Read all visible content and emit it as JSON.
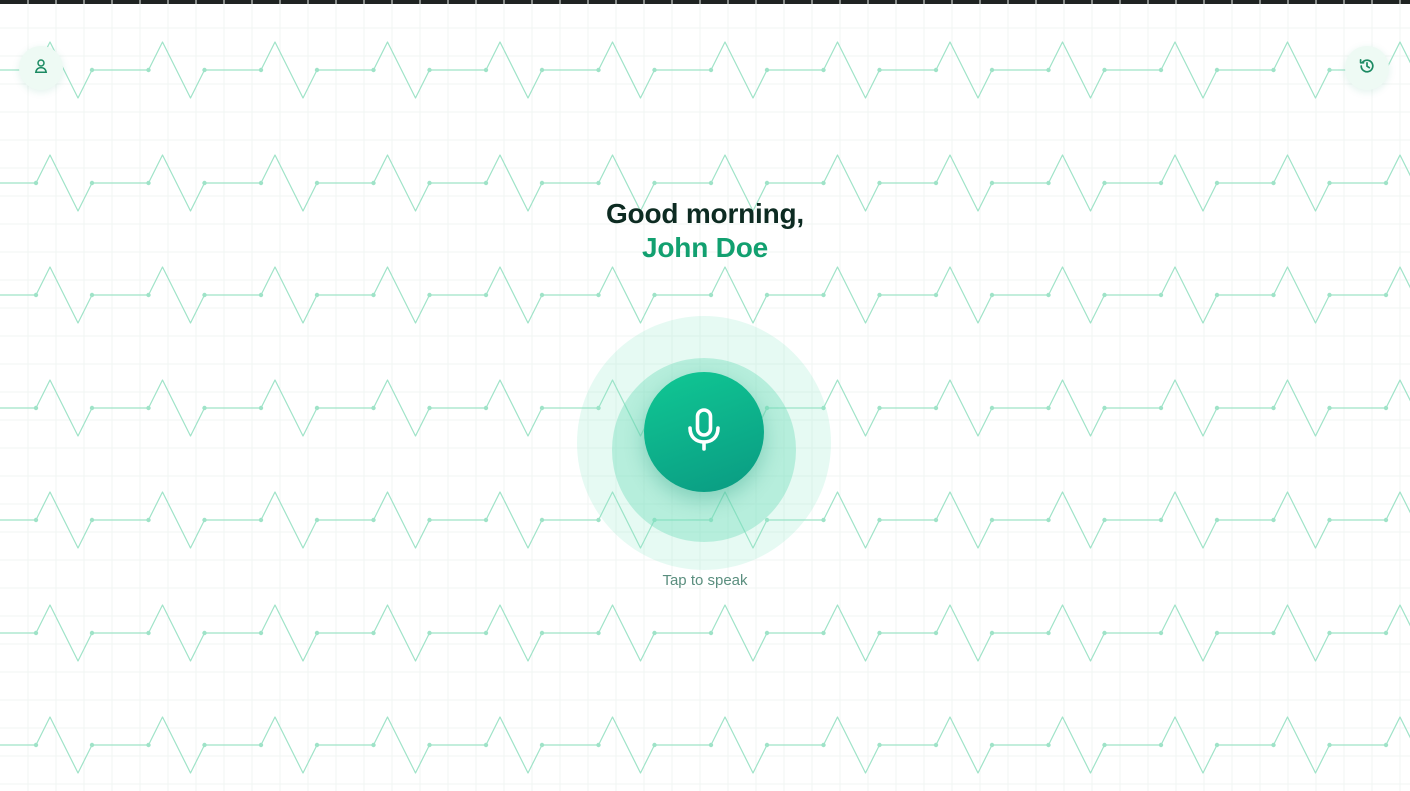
{
  "header": {
    "profile_icon": "user-icon",
    "history_icon": "history-icon"
  },
  "greeting": {
    "salutation": "Good morning,",
    "user_name": "John Doe"
  },
  "voice": {
    "mic_icon": "microphone-icon",
    "hint": "Tap to speak"
  },
  "colors": {
    "accent": "#12a070",
    "mic_gradient_start": "#10c894",
    "mic_gradient_end": "#0a9a82",
    "heading": "#0d2b22",
    "hint": "#5a8e7e",
    "pattern": "#9fe3c8"
  }
}
